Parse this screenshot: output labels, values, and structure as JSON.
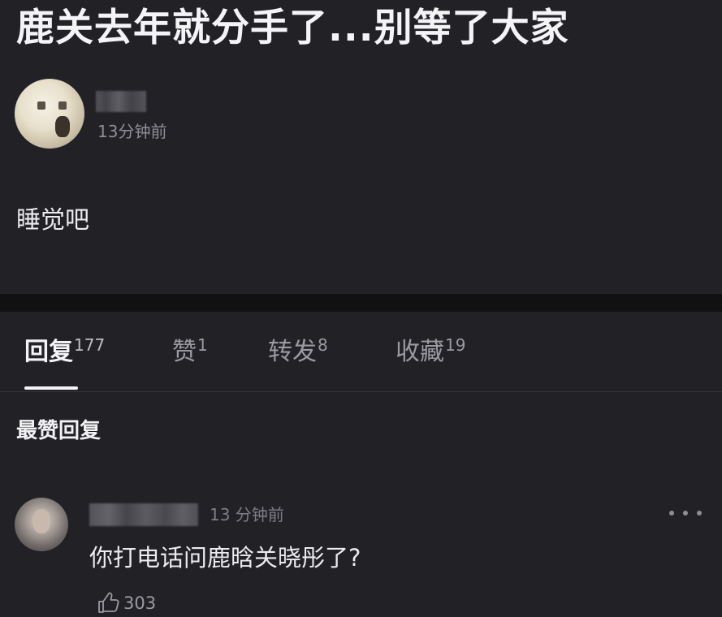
{
  "post": {
    "title": "鹿关去年就分手了...别等了大家",
    "author": {
      "name": "",
      "time": "13分钟前"
    },
    "body": "睡觉吧"
  },
  "tabs": [
    {
      "label": "回复",
      "count": "177",
      "active": true
    },
    {
      "label": "赞",
      "count": "1",
      "active": false
    },
    {
      "label": "转发",
      "count": "8",
      "active": false
    },
    {
      "label": "收藏",
      "count": "19",
      "active": false
    }
  ],
  "section": {
    "heading": "最赞回复"
  },
  "comment": {
    "author": "",
    "time": "13 分钟前",
    "text": "你打电话问鹿晗关晓彤了?",
    "likes": "303"
  },
  "icons": {
    "more": "more-dots-icon",
    "like": "thumbs-up-icon"
  },
  "colors": {
    "background": "#212126",
    "divider": "#111114",
    "text_primary": "#f4f4f6",
    "text_secondary": "#8e8e94"
  }
}
